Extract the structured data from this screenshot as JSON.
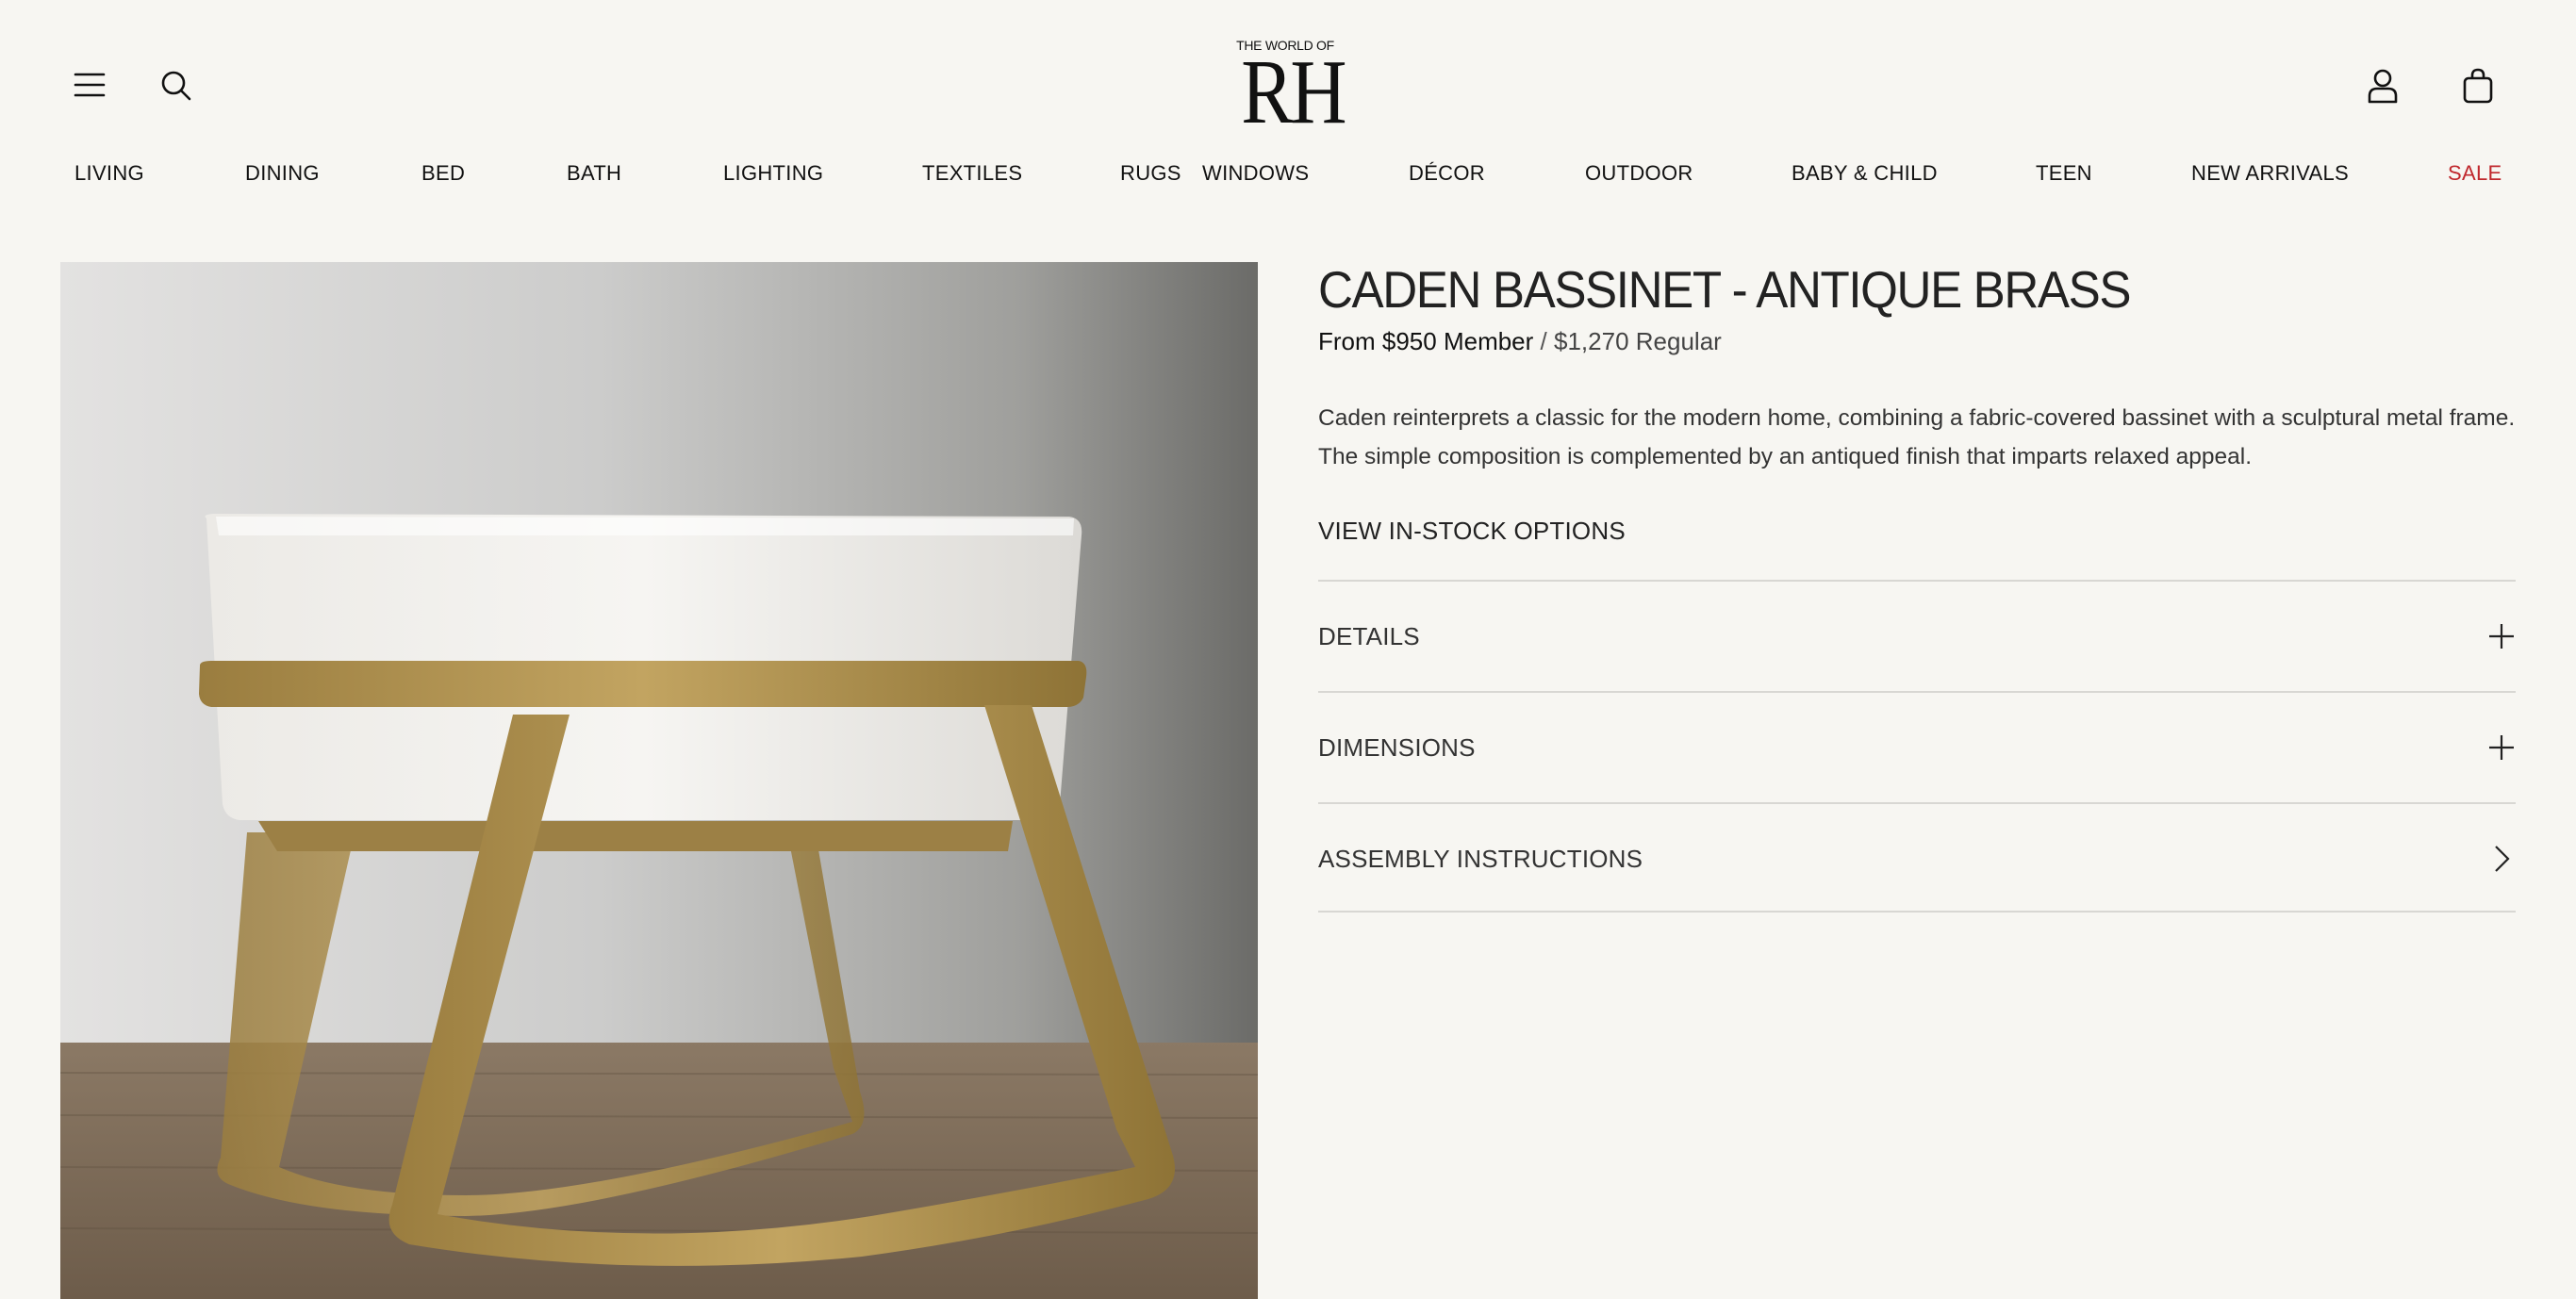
{
  "header": {
    "logo_top": "THE WORLD OF",
    "logo_main": "RH",
    "icons": {
      "menu": "menu-icon",
      "search": "search-icon",
      "account": "account-icon",
      "bag": "shopping-bag-icon"
    }
  },
  "nav": {
    "items": [
      "LIVING",
      "DINING",
      "BED",
      "BATH",
      "LIGHTING",
      "TEXTILES",
      "RUGS",
      "WINDOWS",
      "DÉCOR",
      "OUTDOOR",
      "BABY & CHILD",
      "TEEN",
      "NEW ARRIVALS",
      "SALE"
    ],
    "sale_color": "#c0282d"
  },
  "product": {
    "title": "CADEN BASSINET - ANTIQUE BRASS",
    "price_member": "From $950 Member",
    "price_separator": "/",
    "price_regular": "$1,270 Regular",
    "description": "Caden reinterprets a classic for the modern home, combining a fabric-covered bassinet with a sculptural metal frame. The simple composition is complemented by an antiqued finish that imparts relaxed appeal.",
    "view_in_stock": "VIEW IN-STOCK OPTIONS",
    "accordion": [
      {
        "label": "DETAILS",
        "icon": "plus-icon"
      },
      {
        "label": "DIMENSIONS",
        "icon": "plus-icon"
      },
      {
        "label": "ASSEMBLY INSTRUCTIONS",
        "icon": "chevron-right-icon"
      }
    ]
  },
  "colors": {
    "background": "#f7f6f2",
    "brass": "#b3944f",
    "fabric": "#f1f1ee",
    "floor": "#7d6a55"
  }
}
